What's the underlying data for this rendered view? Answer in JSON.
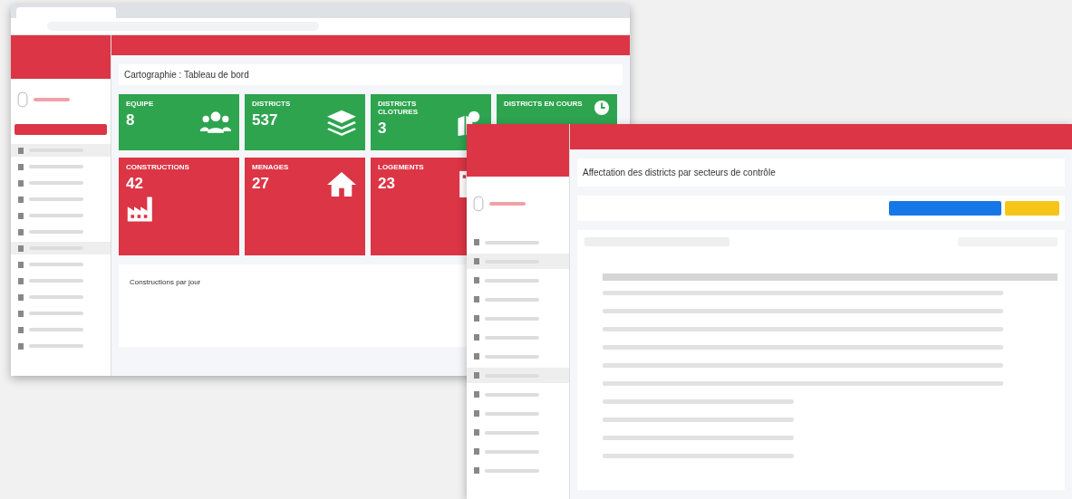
{
  "dashboard_window": {
    "page_title": "Cartographie : Tableau de bord",
    "stat_cards": [
      {
        "label": "EQUIPE",
        "value": "8",
        "color": "#2ea44f",
        "kind": "users"
      },
      {
        "label": "DISTRICTS",
        "value": "537",
        "color": "#2ea44f",
        "kind": "layers"
      },
      {
        "label": "DISTRICTS CLOTURES",
        "value": "3",
        "color": "#2ea44f",
        "kind": "pin"
      },
      {
        "label": "DISTRICTS EN COURS",
        "color": "#2ea44f",
        "kind": "clock"
      },
      {
        "label": "CONSTRUCTIONS",
        "value": "42",
        "color": "#dc3545",
        "kind": "factory"
      },
      {
        "label": "MENAGES",
        "value": "27",
        "color": "#dc3545",
        "kind": "house"
      },
      {
        "label": "LOGEMENTS",
        "value": "23",
        "color": "#dc3545",
        "kind": "building"
      }
    ],
    "panel_title": "Constructions par jour"
  },
  "districts_window": {
    "page_title": "Affectation des districts par secteurs de contrôle"
  }
}
